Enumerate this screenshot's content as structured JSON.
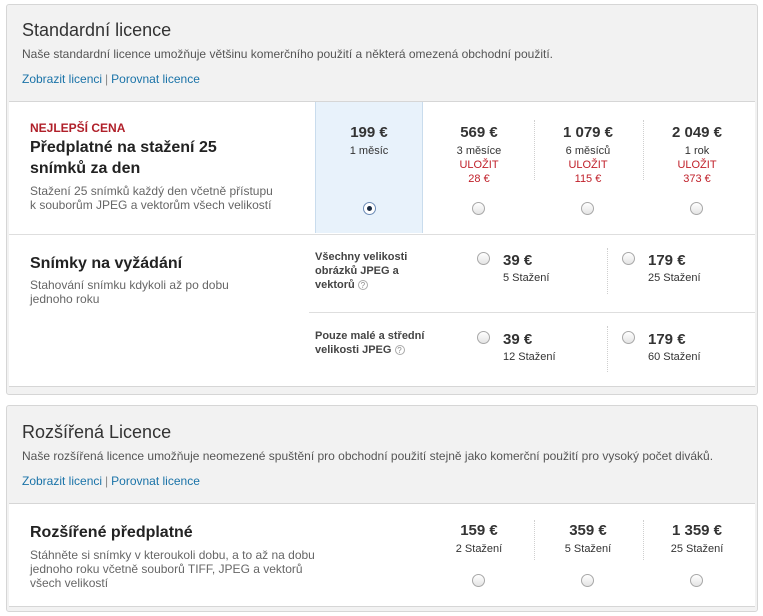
{
  "standard": {
    "title": "Standardní licence",
    "description": "Naše standardní licence umožňuje většinu komerčního použití a některá omezená obchodní použití.",
    "link_show": "Zobrazit licenci",
    "link_separator": "|",
    "link_compare": "Porovnat licence",
    "subscription": {
      "badge": "NEJLEPŠÍ CENA",
      "title": "Předplatné na stažení 25 snímků za den",
      "description": "Stažení 25 snímků každý den včetně přístupu k souborům JPEG a vektorům všech velikostí",
      "plans": [
        {
          "price": "199 €",
          "period": "1 měsíc",
          "save_label": "",
          "save_amount": "",
          "selected": true
        },
        {
          "price": "569 €",
          "period": "3 měsíce",
          "save_label": "ULOŽIT",
          "save_amount": "28 €",
          "selected": false
        },
        {
          "price": "1 079 €",
          "period": "6 měsíců",
          "save_label": "ULOŽIT",
          "save_amount": "115 €",
          "selected": false
        },
        {
          "price": "2 049 €",
          "period": "1 rok",
          "save_label": "ULOŽIT",
          "save_amount": "373 €",
          "selected": false
        }
      ]
    },
    "on_demand": {
      "title": "Snímky na vyžádání",
      "description": "Stahování snímku kdykoli až po dobu jednoho roku",
      "help_glyph": "?",
      "groups": [
        {
          "label": "Všechny velikosti obrázků JPEG a vektorů",
          "options": [
            {
              "price": "39 €",
              "downloads": "5 Stažení"
            },
            {
              "price": "179 €",
              "downloads": "25 Stažení"
            }
          ]
        },
        {
          "label": "Pouze malé a střední velikosti JPEG",
          "options": [
            {
              "price": "39 €",
              "downloads": "12 Stažení"
            },
            {
              "price": "179 €",
              "downloads": "60 Stažení"
            }
          ]
        }
      ]
    }
  },
  "extended": {
    "title": "Rozšířená Licence",
    "description": "Naše rozšířená licence umožňuje neomezené spuštění pro obchodní použití stejně jako komerční použití pro vysoký počet diváků.",
    "link_show": "Zobrazit licenci",
    "link_separator": "|",
    "link_compare": "Porovnat licence",
    "subscription": {
      "title": "Rozšířené předplatné",
      "description": "Stáhněte si snímky v kteroukoli dobu, a to až na dobu jednoho roku včetně souborů TIFF, JPEG a vektorů všech velikostí",
      "plans": [
        {
          "price": "159 €",
          "downloads": "2 Stažení"
        },
        {
          "price": "359 €",
          "downloads": "5 Stažení"
        },
        {
          "price": "1 359 €",
          "downloads": "25 Stažení"
        }
      ]
    }
  },
  "colors": {
    "accent_link": "#1a73a8",
    "save_red": "#c0202a",
    "selected_bg": "#e8f2fb"
  }
}
